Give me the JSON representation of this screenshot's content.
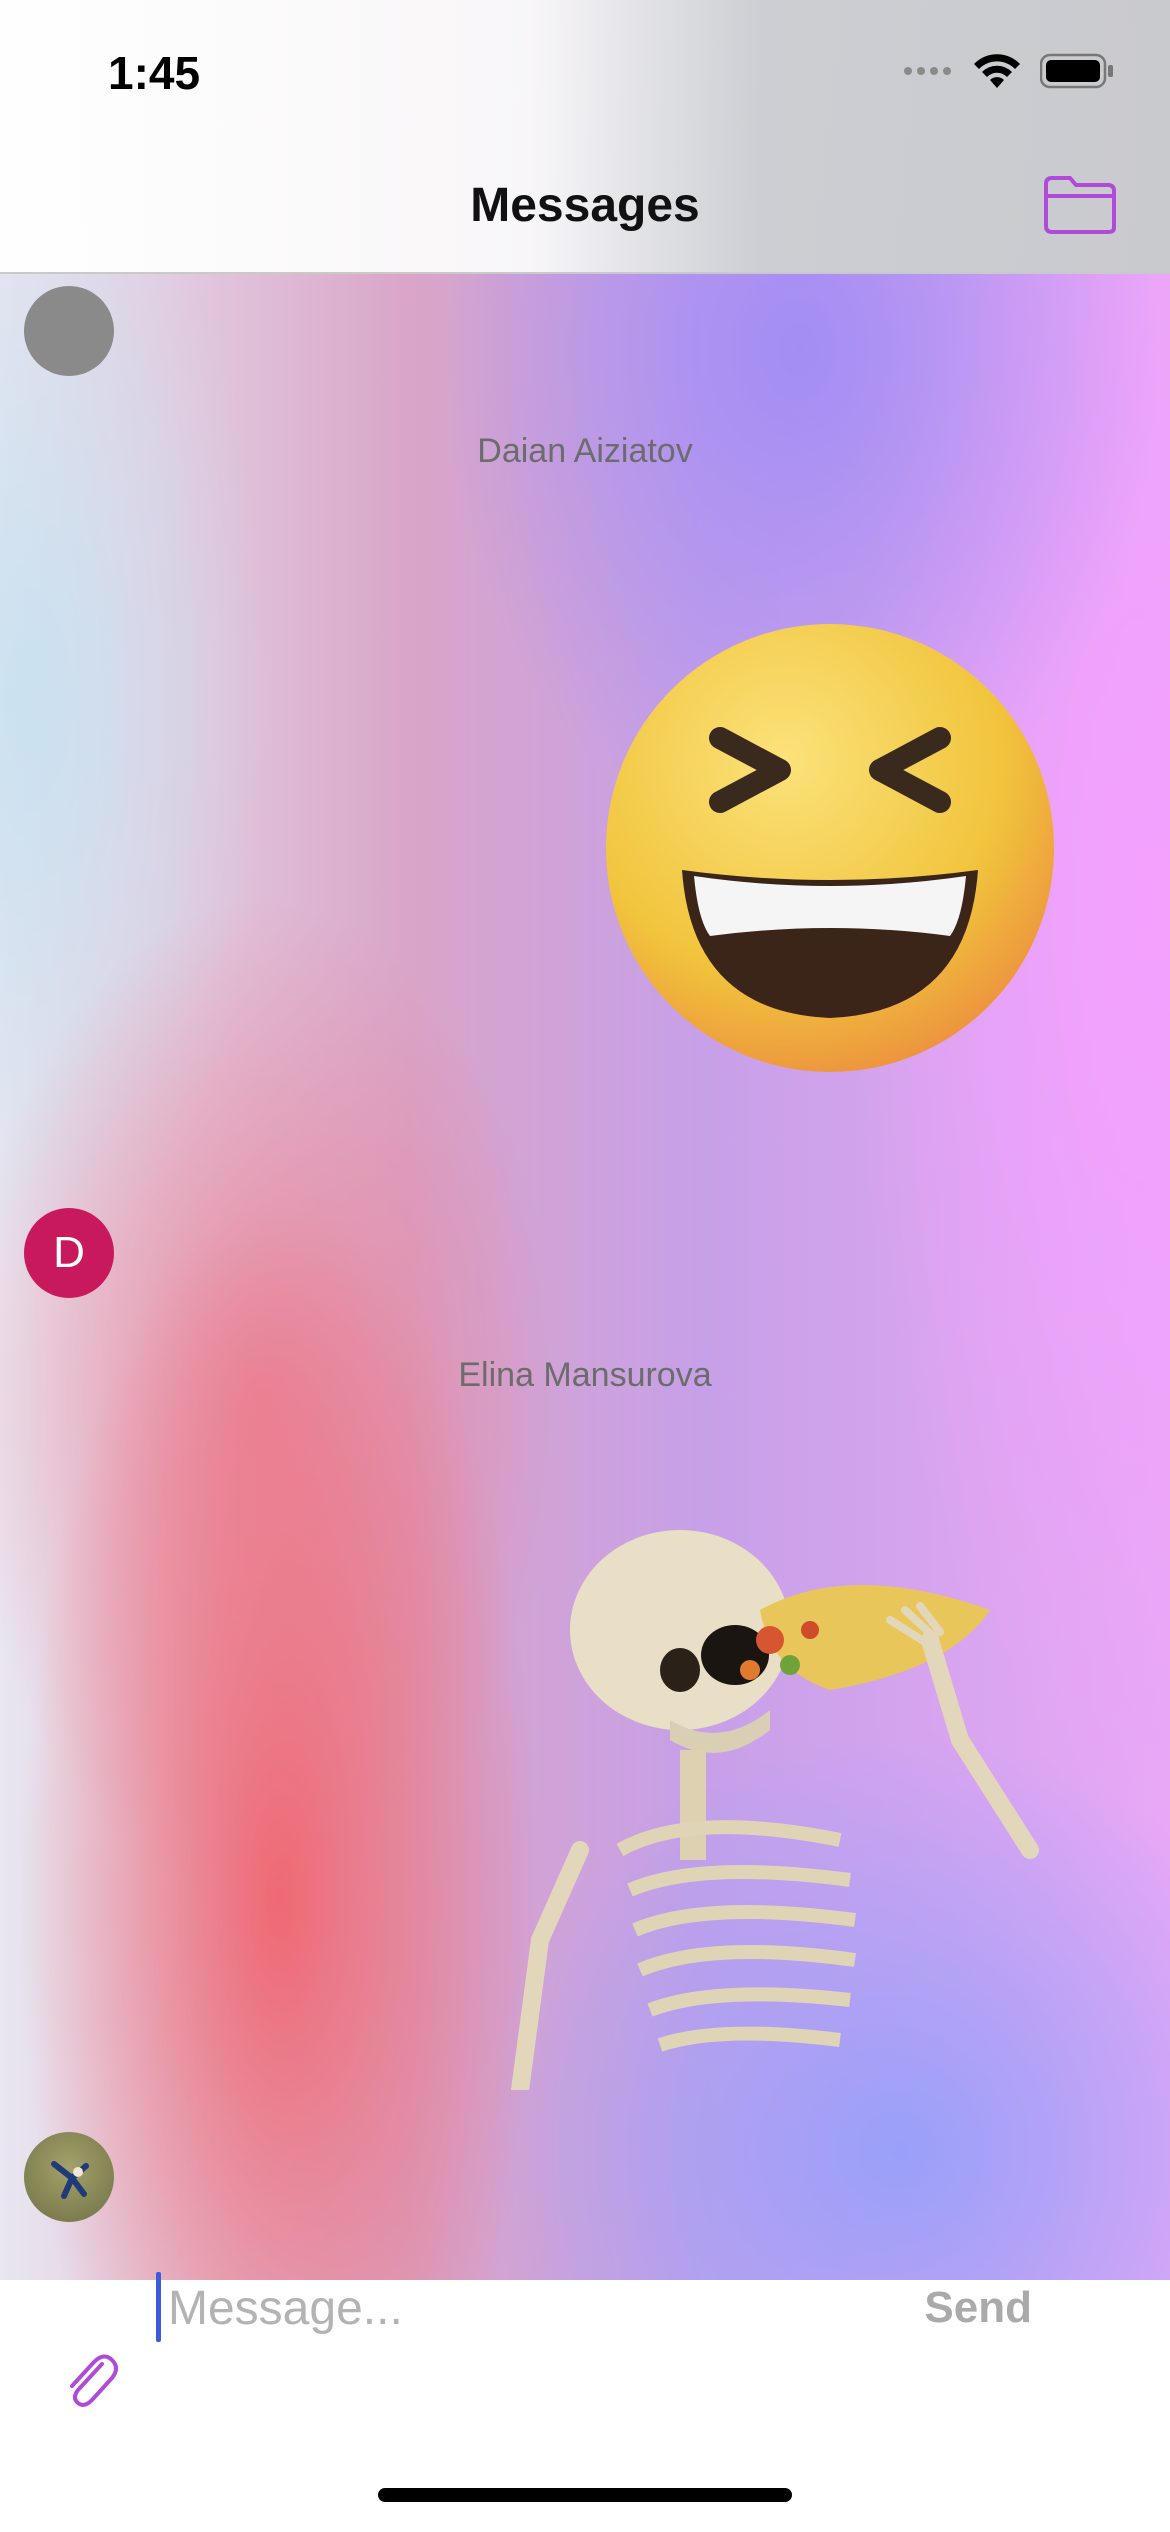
{
  "status_bar": {
    "time": "1:45"
  },
  "header": {
    "title": "Messages",
    "folder_icon": "folder-icon"
  },
  "messages": [
    {
      "sender": "Daian Aiziatov",
      "avatar_color": "#8a8a8a",
      "sticker": "laughing-face-emoji"
    },
    {
      "sender": "Elina Mansurova",
      "avatar_letter": "D",
      "avatar_color": "#c8195c",
      "sticker": "skeleton-eating-taco"
    }
  ],
  "composer": {
    "placeholder": "Message...",
    "send_label": "Send",
    "attach_icon": "paperclip-icon"
  },
  "colors": {
    "accent": "#b04ad8",
    "caret": "#3b5bdb"
  }
}
